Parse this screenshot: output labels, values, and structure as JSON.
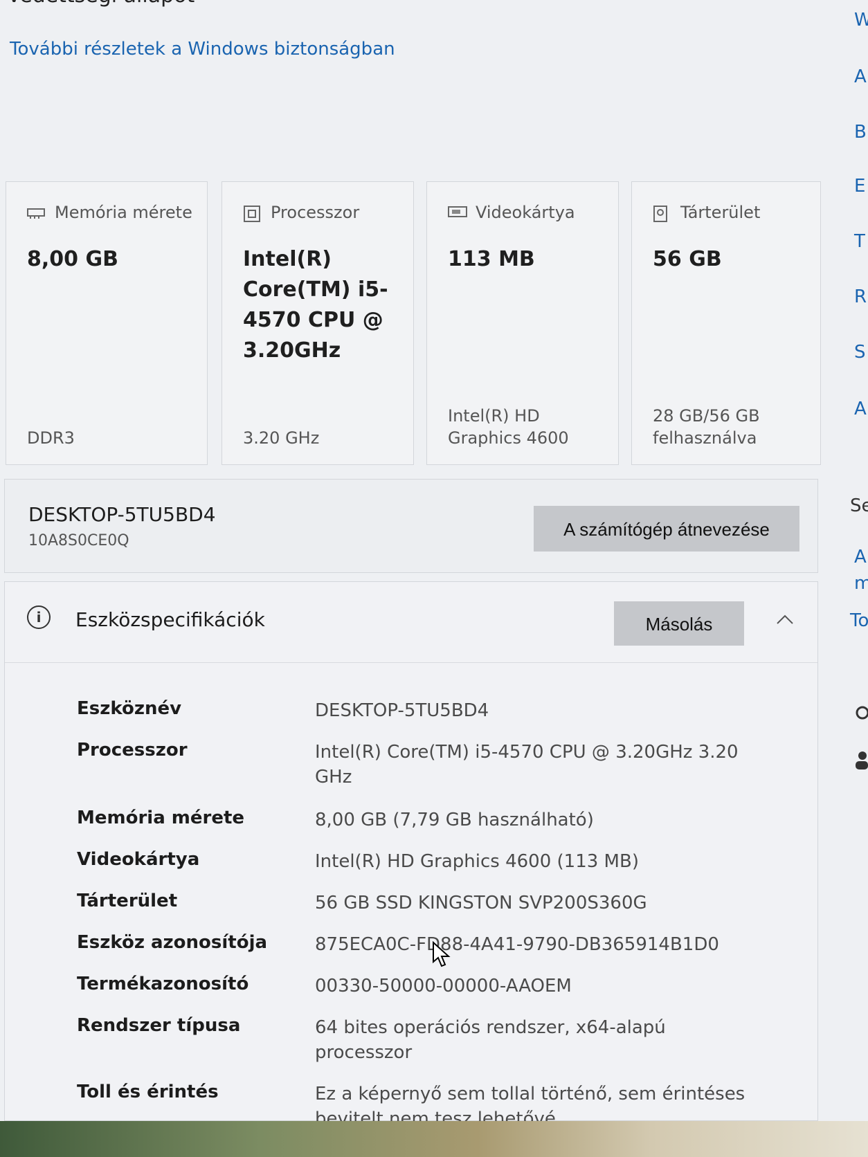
{
  "header": {
    "title": "Védettségi állapot",
    "link": "További részletek a Windows biztonságban"
  },
  "cards": [
    {
      "label": "Memória mérete",
      "value": "8,00 GB",
      "sub": "DDR3",
      "icon": "memory-icon"
    },
    {
      "label": "Processzor",
      "value": "Intel(R) Core(TM) i5-4570 CPU @ 3.20GHz",
      "sub": "3.20 GHz",
      "icon": "processor-icon"
    },
    {
      "label": "Videokártya",
      "value": "113 MB",
      "sub": "Intel(R) HD Graphics 4600",
      "icon": "gpu-icon"
    },
    {
      "label": "Tárterület",
      "value": "56 GB",
      "sub": "28 GB/56 GB felhasználva",
      "icon": "storage-icon"
    }
  ],
  "device": {
    "name": "DESKTOP-5TU5BD4",
    "id": "10A8S0CE0Q",
    "rename_label": "A számítógép átnevezése"
  },
  "specs": {
    "title": "Eszközspecifikációk",
    "copy_label": "Másolás",
    "rows": [
      {
        "key": "Eszköznév",
        "value": "DESKTOP-5TU5BD4"
      },
      {
        "key": "Processzor",
        "value": "Intel(R) Core(TM) i5-4570 CPU @ 3.20GHz   3.20 GHz"
      },
      {
        "key": "Memória mérete",
        "value": "8,00 GB (7,79 GB használható)"
      },
      {
        "key": "Videokártya",
        "value": "Intel(R) HD Graphics 4600 (113 MB)"
      },
      {
        "key": "Tárterület",
        "value": "56 GB SSD KINGSTON SVP200S360G"
      },
      {
        "key": "Eszköz azonosítója",
        "value": "875ECA0C-FD88-4A41-9790-DB365914B1D0"
      },
      {
        "key": "Termékazonosító",
        "value": "00330-50000-00000-AAOEM"
      },
      {
        "key": "Rendszer típusa",
        "value": "64 bites operációs rendszer, x64-alapú processzor"
      },
      {
        "key": "Toll és érintés",
        "value": "Ez a képernyő sem tollal történő, sem érintéses bevitelt nem tesz lehetővé."
      }
    ]
  },
  "right_rail": [
    "W",
    "A",
    "B",
    "E",
    "T",
    "R",
    "S",
    "A",
    "Se",
    "A",
    "m",
    "To"
  ],
  "colors": {
    "accent": "#1a64b0",
    "button": "#c5c7cb",
    "background": "#eef0f3"
  }
}
